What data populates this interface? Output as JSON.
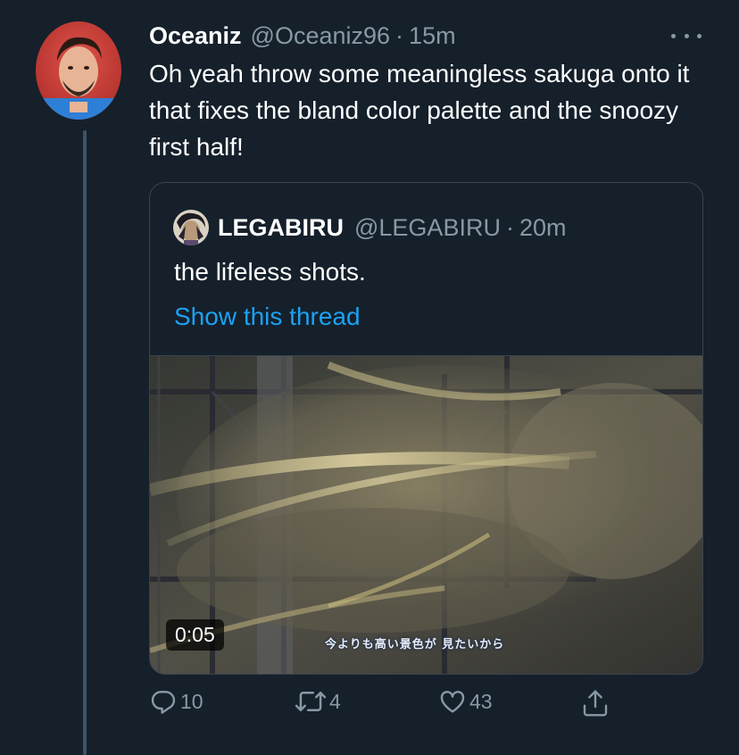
{
  "tweet": {
    "display_name": "Oceaniz",
    "handle": "@Oceaniz96",
    "separator": "·",
    "time": "15m",
    "text": "Oh yeah throw some meaningless sakuga onto it that fixes the bland color palette and the snoozy first half!"
  },
  "quoted": {
    "display_name": "LEGABIRU",
    "handle": "@LEGABIRU",
    "separator": "·",
    "time": "20m",
    "text": "the lifeless shots.",
    "thread_link": "Show this thread",
    "video": {
      "duration": "0:05",
      "subtitle": "今よりも高い景色が 見たいから"
    }
  },
  "actions": {
    "reply_count": "10",
    "retweet_count": "4",
    "like_count": "43"
  },
  "icons": {
    "more": "more-icon",
    "reply": "reply-icon",
    "retweet": "retweet-icon",
    "like": "heart-icon",
    "share": "share-icon"
  },
  "colors": {
    "background": "#15202b",
    "secondary_text": "#8899a6",
    "link": "#1da1f2",
    "border": "#38444d"
  }
}
